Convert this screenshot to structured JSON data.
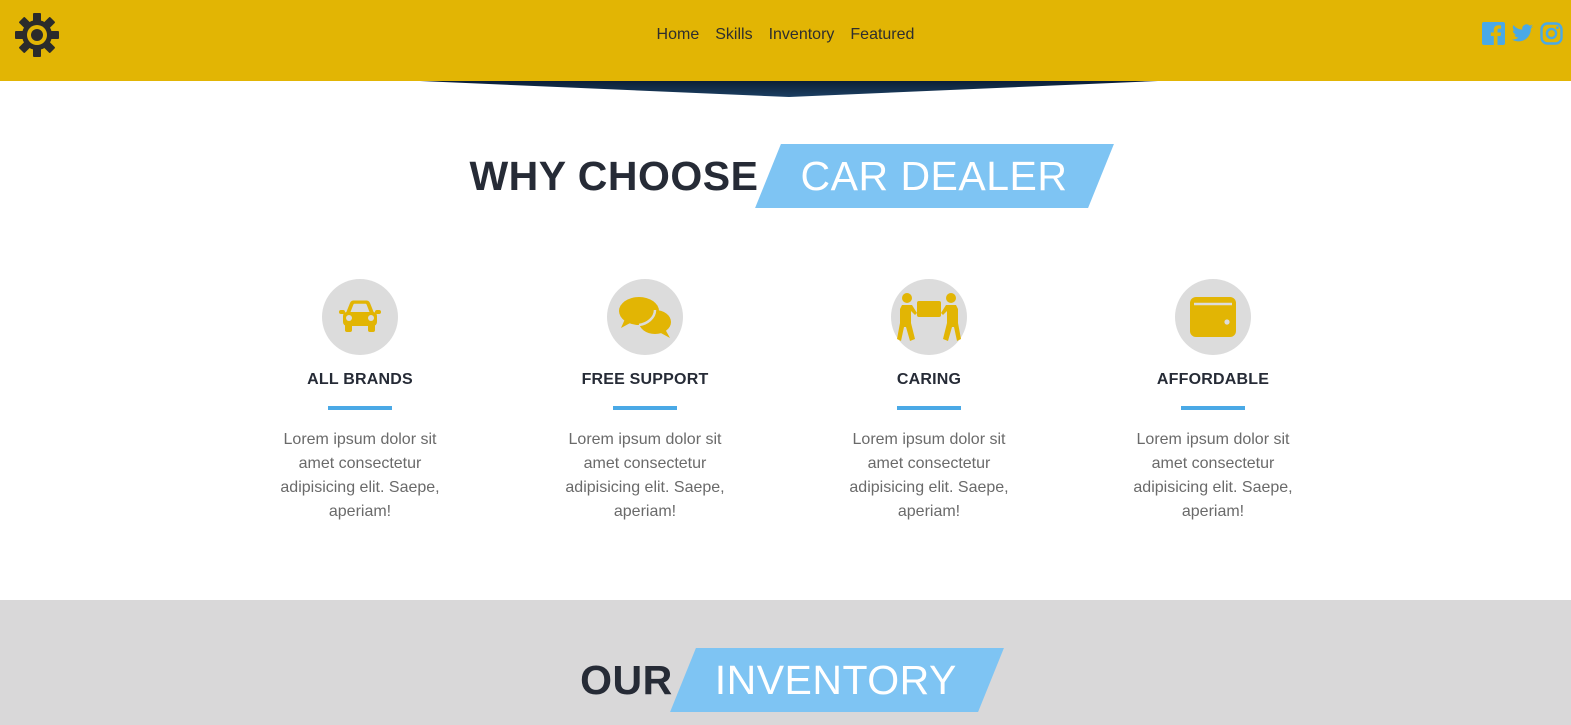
{
  "header": {
    "nav": [
      "Home",
      "Skills",
      "Inventory",
      "Featured"
    ],
    "logo_icon": "gear-icon",
    "social_icons": [
      "facebook-icon",
      "twitter-icon",
      "instagram-icon"
    ],
    "colors": {
      "header_bg": "#e2b504",
      "accent_blue": "#7ec4f3"
    }
  },
  "why": {
    "title_dark": "WHY CHOOSE",
    "title_highlight": "CAR DEALER",
    "features": [
      {
        "icon": "car-icon",
        "title": "ALL BRANDS",
        "desc": "Lorem ipsum dolor sit amet consectetur adipisicing elit. Saepe, aperiam!"
      },
      {
        "icon": "chat-bubbles-icon",
        "title": "FREE SUPPORT",
        "desc": "Lorem ipsum dolor sit amet consectetur adipisicing elit. Saepe, aperiam!"
      },
      {
        "icon": "people-carry-icon",
        "title": "CARING",
        "desc": "Lorem ipsum dolor sit amet consectetur adipisicing elit. Saepe, aperiam!"
      },
      {
        "icon": "wallet-icon",
        "title": "AFFORDABLE",
        "desc": "Lorem ipsum dolor sit amet consectetur adipisicing elit. Saepe, aperiam!"
      }
    ]
  },
  "inventory": {
    "title_dark": "OUR",
    "title_highlight": "INVENTORY"
  }
}
